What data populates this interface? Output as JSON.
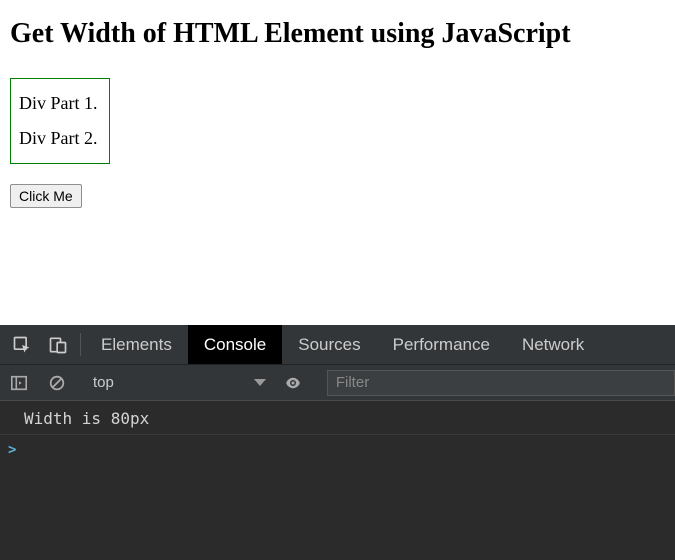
{
  "heading": "Get Width of HTML Element using JavaScript",
  "div_lines": [
    "Div Part 1.",
    "Div Part 2."
  ],
  "button_label": "Click Me",
  "devtools": {
    "tabs": [
      "Elements",
      "Console",
      "Sources",
      "Performance",
      "Network"
    ],
    "active_tab": "Console",
    "context_label": "top",
    "filter_placeholder": "Filter",
    "log_message": "Width is 80px",
    "prompt": ">"
  }
}
